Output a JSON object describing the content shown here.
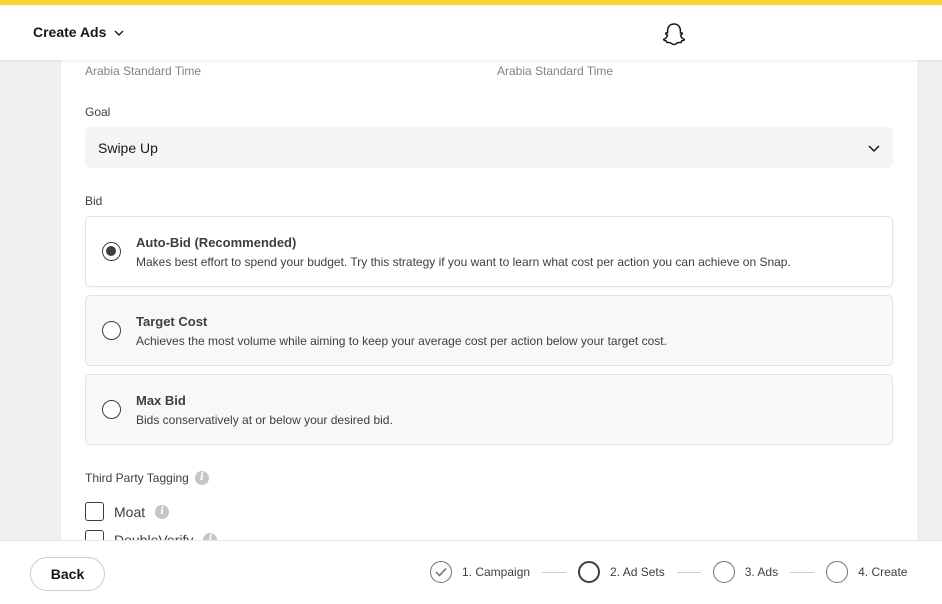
{
  "header": {
    "title": "Create Ads",
    "menu_icon": "chevron-down-icon",
    "logo_icon": "snapchat-ghost-icon"
  },
  "colors": {
    "top_accent": "#f7d633",
    "text": "#16191c",
    "muted": "#7d8389"
  },
  "timezone": {
    "start": "Arabia Standard Time",
    "end": "Arabia Standard Time"
  },
  "goal": {
    "label": "Goal",
    "value": "Swipe Up"
  },
  "bid": {
    "label": "Bid",
    "options": [
      {
        "title": "Auto-Bid (Recommended)",
        "description": "Makes best effort to spend your budget. Try this strategy if you want to learn what cost per action you can achieve on Snap.",
        "selected": true
      },
      {
        "title": "Target Cost",
        "description": "Achieves the most volume while aiming to keep your average cost per action below your target cost.",
        "selected": false
      },
      {
        "title": "Max Bid",
        "description": "Bids conservatively at or below your desired bid.",
        "selected": false
      }
    ]
  },
  "third_party_tagging": {
    "label": "Third Party Tagging",
    "items": [
      {
        "label": "Moat",
        "checked": false
      },
      {
        "label": "DoubleVerify",
        "checked": false
      }
    ]
  },
  "footer": {
    "back_label": "Back",
    "steps": [
      {
        "label": "1. Campaign",
        "status": "completed"
      },
      {
        "label": "2. Ad Sets",
        "status": "current"
      },
      {
        "label": "3. Ads",
        "status": "upcoming"
      },
      {
        "label": "4. Create",
        "status": "upcoming"
      }
    ]
  }
}
